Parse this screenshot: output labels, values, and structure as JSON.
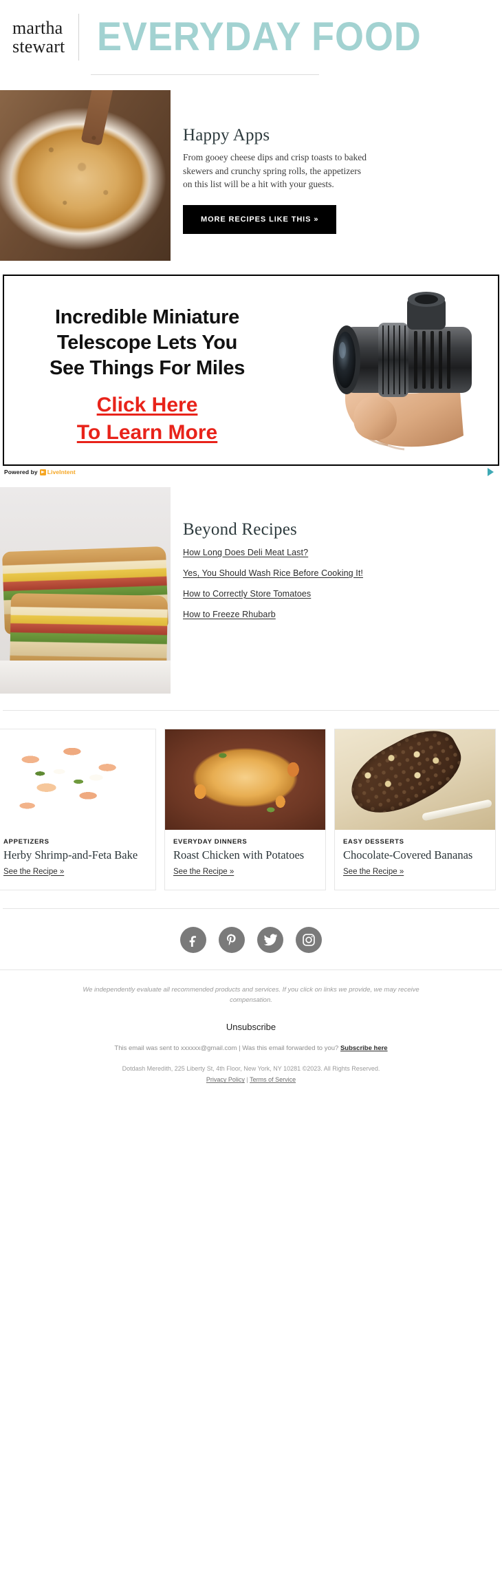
{
  "header": {
    "brand_line1": "martha",
    "brand_line2": "stewart",
    "publication": "EVERYDAY FOOD",
    "accent_color": "#a2d2d1"
  },
  "feature": {
    "image_alt": "baked cheesy gratin appetizer on white plate",
    "heading": "Happy Apps",
    "body": "From gooey cheese dips and crisp toasts to baked skewers and crunchy spring rolls, the appetizers on this list will be a hit with your guests.",
    "cta_label": "MORE RECIPES LIKE THIS »"
  },
  "ad": {
    "headline_line1": "Incredible Miniature",
    "headline_line2": "Telescope Lets You",
    "headline_line3": "See Things For Miles",
    "cta_line1": "Click Here",
    "cta_line2": "To Learn More",
    "image_alt": "hand holding black miniature monocular telescope",
    "powered_by_label": "Powered by",
    "powered_by_brand": "LiveIntent",
    "adchoices_label": "AdChoices",
    "cta_color": "#e8231a",
    "brand_color": "#f5a623"
  },
  "beyond": {
    "image_alt": "two halves of a stacked deli sandwich on a marble board",
    "heading": "Beyond Recipes",
    "links": [
      "How Long Does Deli Meat Last?",
      "Yes, You Should Wash Rice Before Cooking It!",
      "How to Correctly Store Tomatoes",
      "How to Freeze Rhubarb"
    ]
  },
  "cards": [
    {
      "kicker": "APPETIZERS",
      "title": "Herby Shrimp-and-Feta Bake",
      "link": "See the Recipe »",
      "image_alt": "skillet of herby shrimp with feta and potatoes"
    },
    {
      "kicker": "EVERYDAY DINNERS",
      "title": "Roast Chicken with Potatoes",
      "link": "See the Recipe »",
      "image_alt": "roast chicken with potatoes and carrots in a copper pan"
    },
    {
      "kicker": "EASY DESSERTS",
      "title": "Chocolate-Covered Bananas",
      "link": "See the Recipe »",
      "image_alt": "chocolate-covered banana on a stick rolled in nuts"
    }
  ],
  "footer": {
    "social": [
      {
        "name": "facebook",
        "glyph": "f"
      },
      {
        "name": "pinterest",
        "glyph": "P"
      },
      {
        "name": "twitter",
        "glyph": "t"
      },
      {
        "name": "instagram",
        "glyph": "i"
      }
    ],
    "disclaimer": "We independently evaluate all recommended products and services. If you click on links we provide, we may receive compensation.",
    "unsubscribe": "Unsubscribe",
    "sent_to_prefix": "This email was sent to xxxxxx@gmail.com",
    "separator": "|",
    "forwarded_question": "Was this email forwarded to you?",
    "subscribe_link": "Subscribe here",
    "address": "Dotdash Meredith, 225 Liberty St, 4th Floor, New York, NY 10281 ©2023. All Rights Reserved.",
    "privacy_policy": "Privacy Policy",
    "terms_of_service": "Terms of Service",
    "legal_separator": "|"
  }
}
